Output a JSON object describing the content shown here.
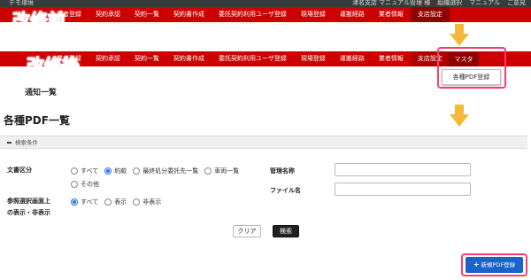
{
  "topbar": {
    "env": "デモ環境",
    "links": [
      "津名支店 マニュアル管理 様",
      "組織選択",
      "マニュアル",
      "ご意見"
    ]
  },
  "nav_before": {
    "items": [
      "",
      "業者登録",
      "契約承認",
      "契約一覧",
      "契約書作成",
      "委託契約利用ユーザ登録",
      "現場登録",
      "運搬経路",
      "業者情報",
      "支店設定"
    ]
  },
  "nav_after": {
    "items": [
      "",
      "業者登録",
      "契約承認",
      "契約一覧",
      "契約書作成",
      "委託契約利用ユーザ登録",
      "現場登録",
      "運搬経路",
      "業者情報",
      "支店設定",
      "マスタ"
    ]
  },
  "labels": {
    "before": "改修前",
    "after": "改修後"
  },
  "dropdown_item": "各種PDF登録",
  "notice_title": "通知一覧",
  "page_title": "各種PDF一覧",
  "panel_title": "検索条件",
  "filters": {
    "document_type": {
      "label": "文書区分",
      "options": [
        "すべて",
        "約款",
        "最終処分委託先一覧",
        "車両一覧",
        "その他"
      ],
      "selected": "約款"
    },
    "display": {
      "label_line1": "参照選択画面上",
      "label_line2": "の表示・非表示",
      "options": [
        "すべて",
        "表示",
        "非表示"
      ],
      "selected": "すべて"
    },
    "manager_name": {
      "label": "管理名称",
      "value": ""
    },
    "file_name": {
      "label": "ファイル名",
      "value": ""
    }
  },
  "buttons": {
    "clear": "クリア",
    "search": "検索",
    "new_pdf": "新規PDF登録"
  },
  "colors": {
    "nav": "#cc0000",
    "highlight": "#ff3b6e",
    "arrow": "#f5b93a",
    "primary": "#1a63c9"
  }
}
